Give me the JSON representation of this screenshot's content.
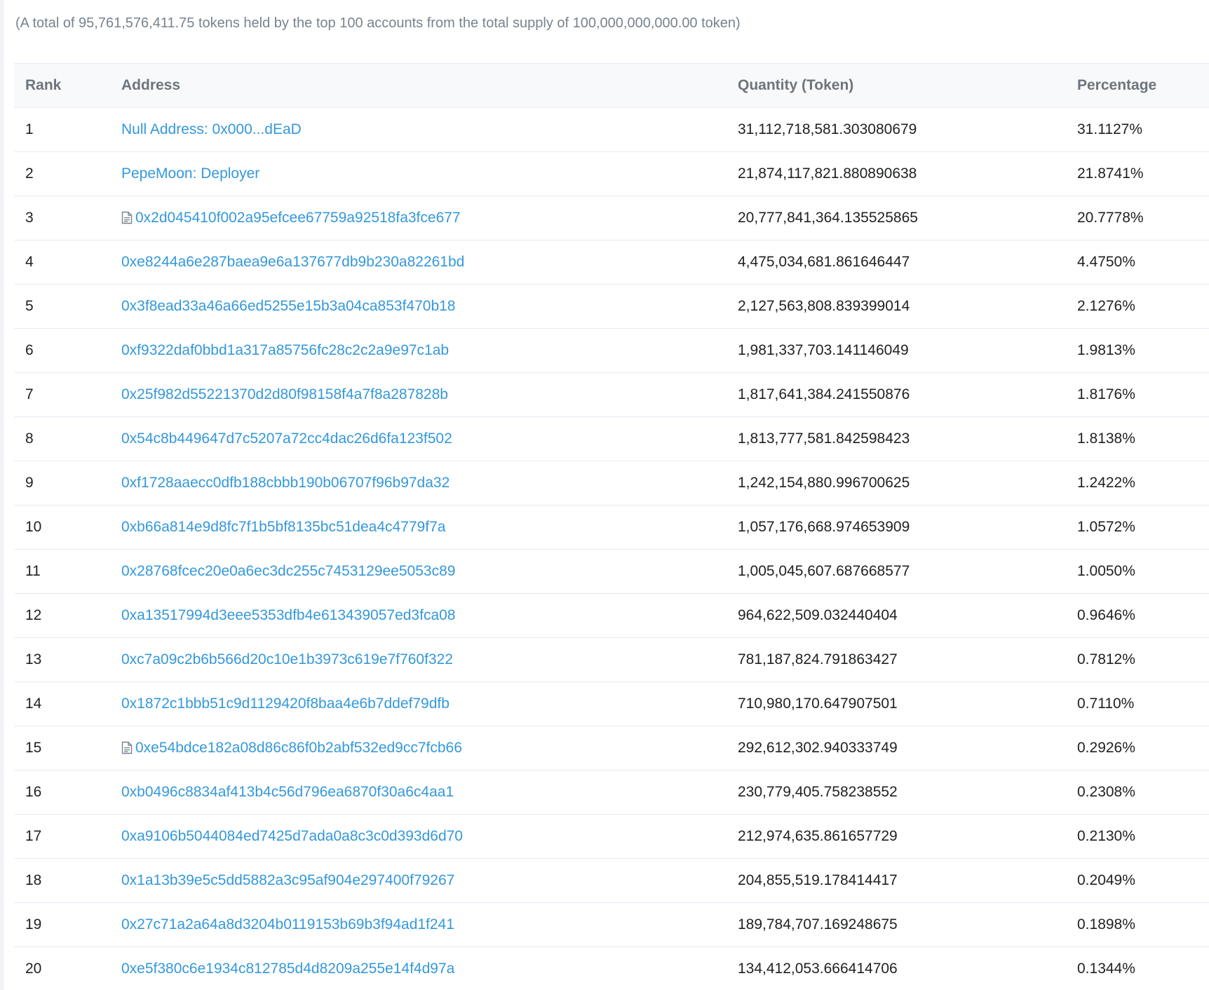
{
  "summary": "(A total of 95,761,576,411.75 tokens held by the top 100 accounts from the total supply of 100,000,000,000.00 token)",
  "table": {
    "headers": {
      "rank": "Rank",
      "address": "Address",
      "quantity": "Quantity (Token)",
      "percentage": "Percentage"
    },
    "rows": [
      {
        "rank": "1",
        "address": "Null Address: 0x000...dEaD",
        "contract": false,
        "quantity": "31,112,718,581.303080679",
        "percentage": "31.1127%"
      },
      {
        "rank": "2",
        "address": "PepeMoon: Deployer",
        "contract": false,
        "quantity": "21,874,117,821.880890638",
        "percentage": "21.8741%"
      },
      {
        "rank": "3",
        "address": "0x2d045410f002a95efcee67759a92518fa3fce677",
        "contract": true,
        "icon": "contract-file-icon",
        "quantity": "20,777,841,364.135525865",
        "percentage": "20.7778%"
      },
      {
        "rank": "4",
        "address": "0xe8244a6e287baea9e6a137677db9b230a82261bd",
        "contract": false,
        "quantity": "4,475,034,681.861646447",
        "percentage": "4.4750%"
      },
      {
        "rank": "5",
        "address": "0x3f8ead33a46a66ed5255e15b3a04ca853f470b18",
        "contract": false,
        "quantity": "2,127,563,808.839399014",
        "percentage": "2.1276%"
      },
      {
        "rank": "6",
        "address": "0xf9322daf0bbd1a317a85756fc28c2c2a9e97c1ab",
        "contract": false,
        "quantity": "1,981,337,703.141146049",
        "percentage": "1.9813%"
      },
      {
        "rank": "7",
        "address": "0x25f982d55221370d2d80f98158f4a7f8a287828b",
        "contract": false,
        "quantity": "1,817,641,384.241550876",
        "percentage": "1.8176%"
      },
      {
        "rank": "8",
        "address": "0x54c8b449647d7c5207a72cc4dac26d6fa123f502",
        "contract": false,
        "quantity": "1,813,777,581.842598423",
        "percentage": "1.8138%"
      },
      {
        "rank": "9",
        "address": "0xf1728aaecc0dfb188cbbb190b06707f96b97da32",
        "contract": false,
        "quantity": "1,242,154,880.996700625",
        "percentage": "1.2422%"
      },
      {
        "rank": "10",
        "address": "0xb66a814e9d8fc7f1b5bf8135bc51dea4c4779f7a",
        "contract": false,
        "quantity": "1,057,176,668.974653909",
        "percentage": "1.0572%"
      },
      {
        "rank": "11",
        "address": "0x28768fcec20e0a6ec3dc255c7453129ee5053c89",
        "contract": false,
        "quantity": "1,005,045,607.687668577",
        "percentage": "1.0050%"
      },
      {
        "rank": "12",
        "address": "0xa13517994d3eee5353dfb4e613439057ed3fca08",
        "contract": false,
        "quantity": "964,622,509.032440404",
        "percentage": "0.9646%"
      },
      {
        "rank": "13",
        "address": "0xc7a09c2b6b566d20c10e1b3973c619e7f760f322",
        "contract": false,
        "quantity": "781,187,824.791863427",
        "percentage": "0.7812%"
      },
      {
        "rank": "14",
        "address": "0x1872c1bbb51c9d1129420f8baa4e6b7ddef79dfb",
        "contract": false,
        "quantity": "710,980,170.647907501",
        "percentage": "0.7110%"
      },
      {
        "rank": "15",
        "address": "0xe54bdce182a08d86c86f0b2abf532ed9cc7fcb66",
        "contract": true,
        "icon": "contract-file-icon",
        "quantity": "292,612,302.940333749",
        "percentage": "0.2926%"
      },
      {
        "rank": "16",
        "address": "0xb0496c8834af413b4c56d796ea6870f30a6c4aa1",
        "contract": false,
        "quantity": "230,779,405.758238552",
        "percentage": "0.2308%"
      },
      {
        "rank": "17",
        "address": "0xa9106b5044084ed7425d7ada0a8c3c0d393d6d70",
        "contract": false,
        "quantity": "212,974,635.861657729",
        "percentage": "0.2130%"
      },
      {
        "rank": "18",
        "address": "0x1a13b39e5c5dd5882a3c95af904e297400f79267",
        "contract": false,
        "quantity": "204,855,519.178414417",
        "percentage": "0.2049%"
      },
      {
        "rank": "19",
        "address": "0x27c71a2a64a8d3204b0119153b69b3f94ad1f241",
        "contract": false,
        "quantity": "189,784,707.169248675",
        "percentage": "0.1898%"
      },
      {
        "rank": "20",
        "address": "0xe5f380c6e1934c812785d4d8209a255e14f4d97a",
        "contract": false,
        "quantity": "134,412,053.666414706",
        "percentage": "0.1344%"
      }
    ]
  },
  "colors": {
    "link": "#3498db",
    "text": "#1e2022",
    "muted": "#77838f",
    "header_bg": "#f8f9fa",
    "border": "#e7eaf3"
  }
}
